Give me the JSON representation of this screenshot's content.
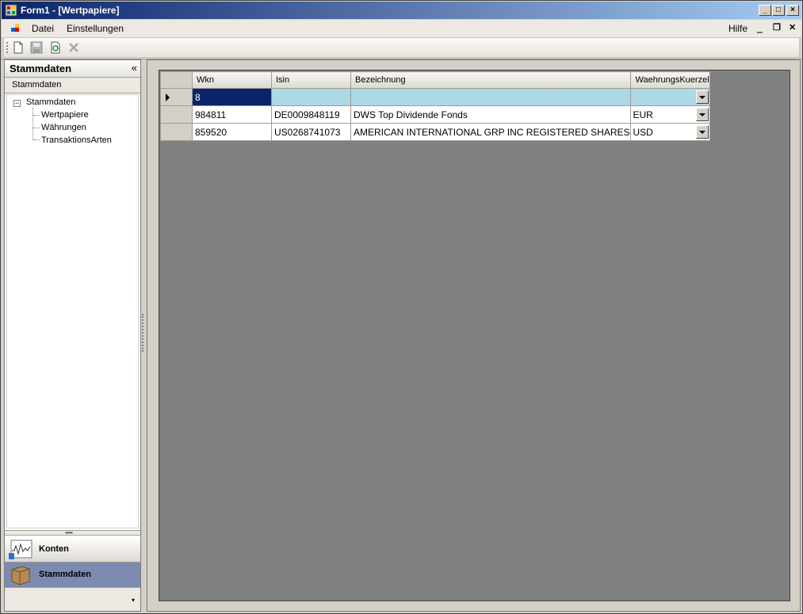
{
  "window": {
    "title": "Form1 - [Wertpapiere]",
    "min": "_",
    "max": "□",
    "close": "×"
  },
  "menu": {
    "items": [
      "Datei",
      "Einstellungen"
    ],
    "help": "Hilfe",
    "mdi_min": "‗",
    "mdi_restore": "❐",
    "mdi_close": "✕"
  },
  "toolbar": {
    "icons": [
      "new-icon",
      "save-icon",
      "refresh-icon",
      "delete-icon"
    ]
  },
  "left_panel": {
    "header": "Stammdaten",
    "collapse": "«",
    "subheader": "Stammdaten",
    "tree": {
      "root": "Stammdaten",
      "expander": "−",
      "children": [
        "Wertpapiere",
        "Währungen",
        "TransaktionsArten"
      ]
    },
    "grip": "•••••",
    "nav": [
      {
        "label": "Konten",
        "icon": "chart-icon"
      },
      {
        "label": "Stammdaten",
        "icon": "box-icon"
      }
    ],
    "footer_arrow": "▾"
  },
  "grid": {
    "columns": [
      "Wkn",
      "Isin",
      "Bezeichnung",
      "WaehrungsKuerzel"
    ],
    "rows": [
      {
        "wkn": "8",
        "isin": "",
        "bezeichnung": "",
        "waehrung": ""
      },
      {
        "wkn": "984811",
        "isin": "DE0009848119",
        "bezeichnung": "DWS Top Dividende Fonds",
        "waehrung": "EUR"
      },
      {
        "wkn": "859520",
        "isin": "US0268741073",
        "bezeichnung": "AMERICAN INTERNATIONAL GRP INC REGISTERED SHARES",
        "waehrung": "USD"
      }
    ]
  }
}
